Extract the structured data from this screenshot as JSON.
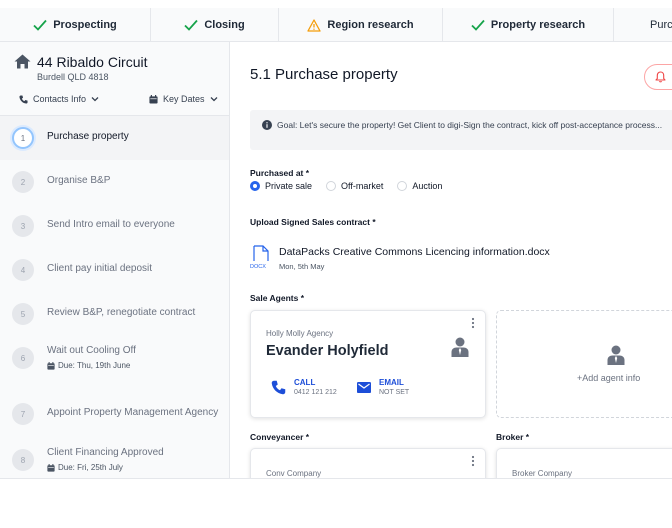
{
  "stages": [
    {
      "label": "Prospecting",
      "status": "complete"
    },
    {
      "label": "Closing",
      "status": "complete"
    },
    {
      "label": "Region research",
      "status": "warning"
    },
    {
      "label": "Property research",
      "status": "complete"
    },
    {
      "label": "Purc",
      "status": "current"
    }
  ],
  "colors": {
    "check": "#16a34a",
    "warning": "#f59e0b",
    "accent": "#2563eb",
    "danger": "#ef4444"
  },
  "property": {
    "street": "44 Ribaldo Circuit",
    "suburb": "Burdell QLD 4818"
  },
  "sidebar": {
    "contacts_label": "Contacts Info",
    "dates_label": "Key Dates",
    "steps": [
      {
        "num": "1",
        "label": "Purchase property"
      },
      {
        "num": "2",
        "label": "Organise B&P"
      },
      {
        "num": "3",
        "label": "Send Intro email to everyone"
      },
      {
        "num": "4",
        "label": "Client pay initial deposit"
      },
      {
        "num": "5",
        "label": "Review B&P, renegotiate contract"
      },
      {
        "num": "6",
        "label": "Wait out Cooling Off",
        "due": "Due: Thu, 19th June"
      },
      {
        "num": "7",
        "label": "Appoint Property Management Agency"
      },
      {
        "num": "8",
        "label": "Client Financing Approved",
        "due": "Due: Fri, 25th July"
      }
    ]
  },
  "main": {
    "title": "5.1 Purchase property",
    "goal": "Goal: Let's secure the property! Get Client to digi-Sign the contract, kick off post-acceptance process...",
    "purchased_at": {
      "label": "Purchased at *",
      "options": [
        "Private sale",
        "Off-market",
        "Auction"
      ],
      "selected": "Private sale"
    },
    "upload": {
      "label": "Upload Signed Sales contract *",
      "file_type": "DOCX",
      "file_name": "DataPacks Creative Commons Licencing information.docx",
      "file_date": "Mon, 5th May"
    },
    "sale_agents": {
      "label": "Sale Agents *",
      "agency": "Holly Molly Agency",
      "name": "Evander Holyfield",
      "call_label": "CALL",
      "phone": "0412 121 212",
      "email_label": "EMAIL",
      "email": "NOT SET",
      "add_label": "+Add agent info"
    },
    "conveyancer": {
      "label": "Conveyancer *",
      "company": "Conv Company"
    },
    "broker": {
      "label": "Broker *",
      "company": "Broker Company"
    }
  }
}
